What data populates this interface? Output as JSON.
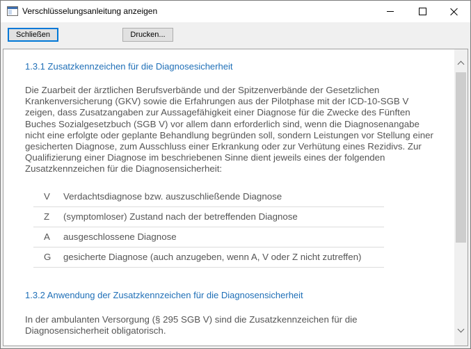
{
  "window": {
    "title": "Verschlüsselungsanleitung anzeigen"
  },
  "toolbar": {
    "close_label": "Schließen",
    "print_label": "Drucken..."
  },
  "document": {
    "section1": {
      "heading": "1.3.1 Zusatzkennzeichen für die Diagnosesicherheit",
      "paragraph": "Die Zuarbeit der ärztlichen Berufsverbände und der Spitzenverbände der Gesetzlichen Krankenversicherung (GKV) sowie die Erfahrungen aus der Pilotphase mit der ICD-10-SGB V zeigen, dass Zusatzangaben zur Aussagefähigkeit einer Diagnose für die Zwecke des Fünften Buches Sozialgesetzbuch (SGB V) vor allem dann erforderlich sind, wenn die Diagnosenangabe nicht eine erfolgte oder geplante Behandlung begründen soll, sondern Leistungen vor Stellung einer gesicherten Diagnose, zum Ausschluss einer Erkrankung oder zur Verhütung eines Rezidivs. Zur Qualifizierung einer Diagnose im beschriebenen Sinne dient jeweils eines der folgenden Zusatzkennzeichen für die Diagnosensicherheit:",
      "codes": [
        {
          "code": "V",
          "description": "Verdachtsdiagnose bzw. auszuschließende Diagnose"
        },
        {
          "code": "Z",
          "description": "(symptomloser) Zustand nach der betreffenden Diagnose"
        },
        {
          "code": "A",
          "description": "ausgeschlossene Diagnose"
        },
        {
          "code": "G",
          "description": "gesicherte Diagnose (auch anzugeben, wenn A, V oder Z nicht zutreffen)"
        }
      ]
    },
    "section2": {
      "heading": "1.3.2 Anwendung der Zusatzkennzeichen für die Diagnosensicherheit",
      "paragraph": "In der ambulanten Versorgung (§ 295 SGB V) sind die Zusatzkennzeichen für die Diagnosensicherheit obligatorisch."
    }
  },
  "icons": {
    "app": "window-app-icon",
    "minimize": "minimize-icon",
    "maximize": "maximize-icon",
    "close": "close-icon",
    "scroll_up": "chevron-up-icon",
    "scroll_down": "chevron-down-icon"
  },
  "colors": {
    "heading": "#1f6fb7",
    "body_text": "#555555",
    "focus_border": "#0078d7"
  }
}
